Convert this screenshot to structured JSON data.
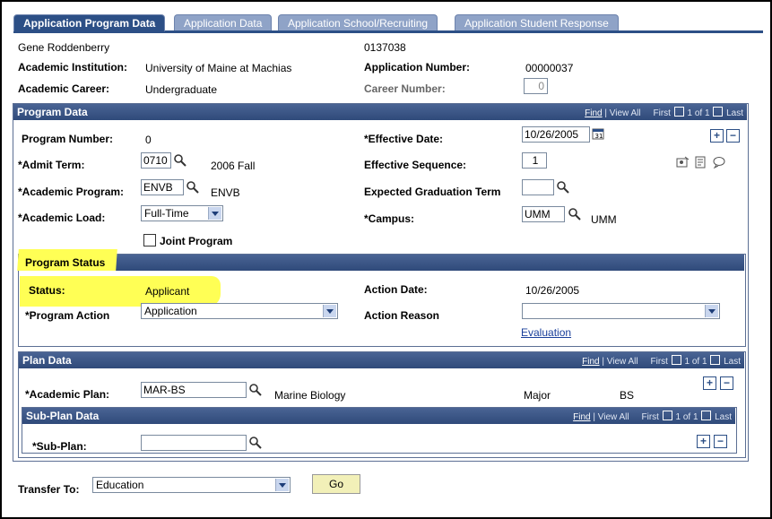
{
  "tabs": [
    {
      "label": "Application Program Data"
    },
    {
      "label": "Application Data"
    },
    {
      "label": "Application School/Recruiting"
    },
    {
      "label": "Application Student Response"
    }
  ],
  "header": {
    "name": "Gene Roddenberry",
    "id": "0137038",
    "institution_label": "Academic Institution:",
    "institution_value": "University of Maine at Machias",
    "app_number_label": "Application Number:",
    "app_number_value": "00000037",
    "career_label": "Academic Career:",
    "career_value": "Undergraduate",
    "career_number_label": "Career Number:",
    "career_number_value": "0"
  },
  "program_data": {
    "title": "Program Data",
    "nav": {
      "find": "Find",
      "view_all": "View All",
      "first": "First",
      "range": "1 of 1",
      "last": "Last"
    },
    "program_number_label": "Program Number:",
    "program_number_value": "0",
    "effective_date_label": "*Effective Date:",
    "effective_date_value": "10/26/2005",
    "admit_term_label": "*Admit Term:",
    "admit_term_value": "0710",
    "admit_term_desc": "2006 Fall",
    "effective_seq_label": "Effective Sequence:",
    "effective_seq_value": "1",
    "academic_program_label": "*Academic Program:",
    "academic_program_value": "ENVB",
    "academic_program_desc": "ENVB",
    "expected_grad_label": "Expected Graduation Term",
    "expected_grad_value": "",
    "academic_load_label": "*Academic Load:",
    "academic_load_value": "Full-Time",
    "campus_label": "*Campus:",
    "campus_value": "UMM",
    "campus_desc": "UMM",
    "joint_program_label": "Joint Program"
  },
  "program_status": {
    "title": "Program Status",
    "status_label": "Status:",
    "status_value": "Applicant",
    "action_date_label": "Action Date:",
    "action_date_value": "10/26/2005",
    "program_action_label": "*Program Action",
    "program_action_value": "Application",
    "action_reason_label": "Action Reason",
    "action_reason_value": "",
    "evaluation_link": "Evaluation"
  },
  "plan_data": {
    "title": "Plan Data",
    "nav": {
      "find": "Find",
      "view_all": "View All",
      "first": "First",
      "range": "1 of 1",
      "last": "Last"
    },
    "academic_plan_label": "*Academic Plan:",
    "academic_plan_value": "MAR-BS",
    "academic_plan_desc": "Marine Biology",
    "plan_type": "Major",
    "plan_degree": "BS"
  },
  "subplan_data": {
    "title": "Sub-Plan Data",
    "nav": {
      "find": "Find",
      "view_all": "View All",
      "first": "First",
      "range": "1 of 1",
      "last": "Last"
    },
    "subplan_label": "*Sub-Plan:",
    "subplan_value": ""
  },
  "transfer": {
    "label": "Transfer To:",
    "value": "Education",
    "go_label": "Go"
  },
  "colors": {
    "header_blue": "#2c4f86",
    "tab_inactive": "#8fa3c7",
    "highlight": "#ffff55",
    "link": "#1a3f9a"
  }
}
